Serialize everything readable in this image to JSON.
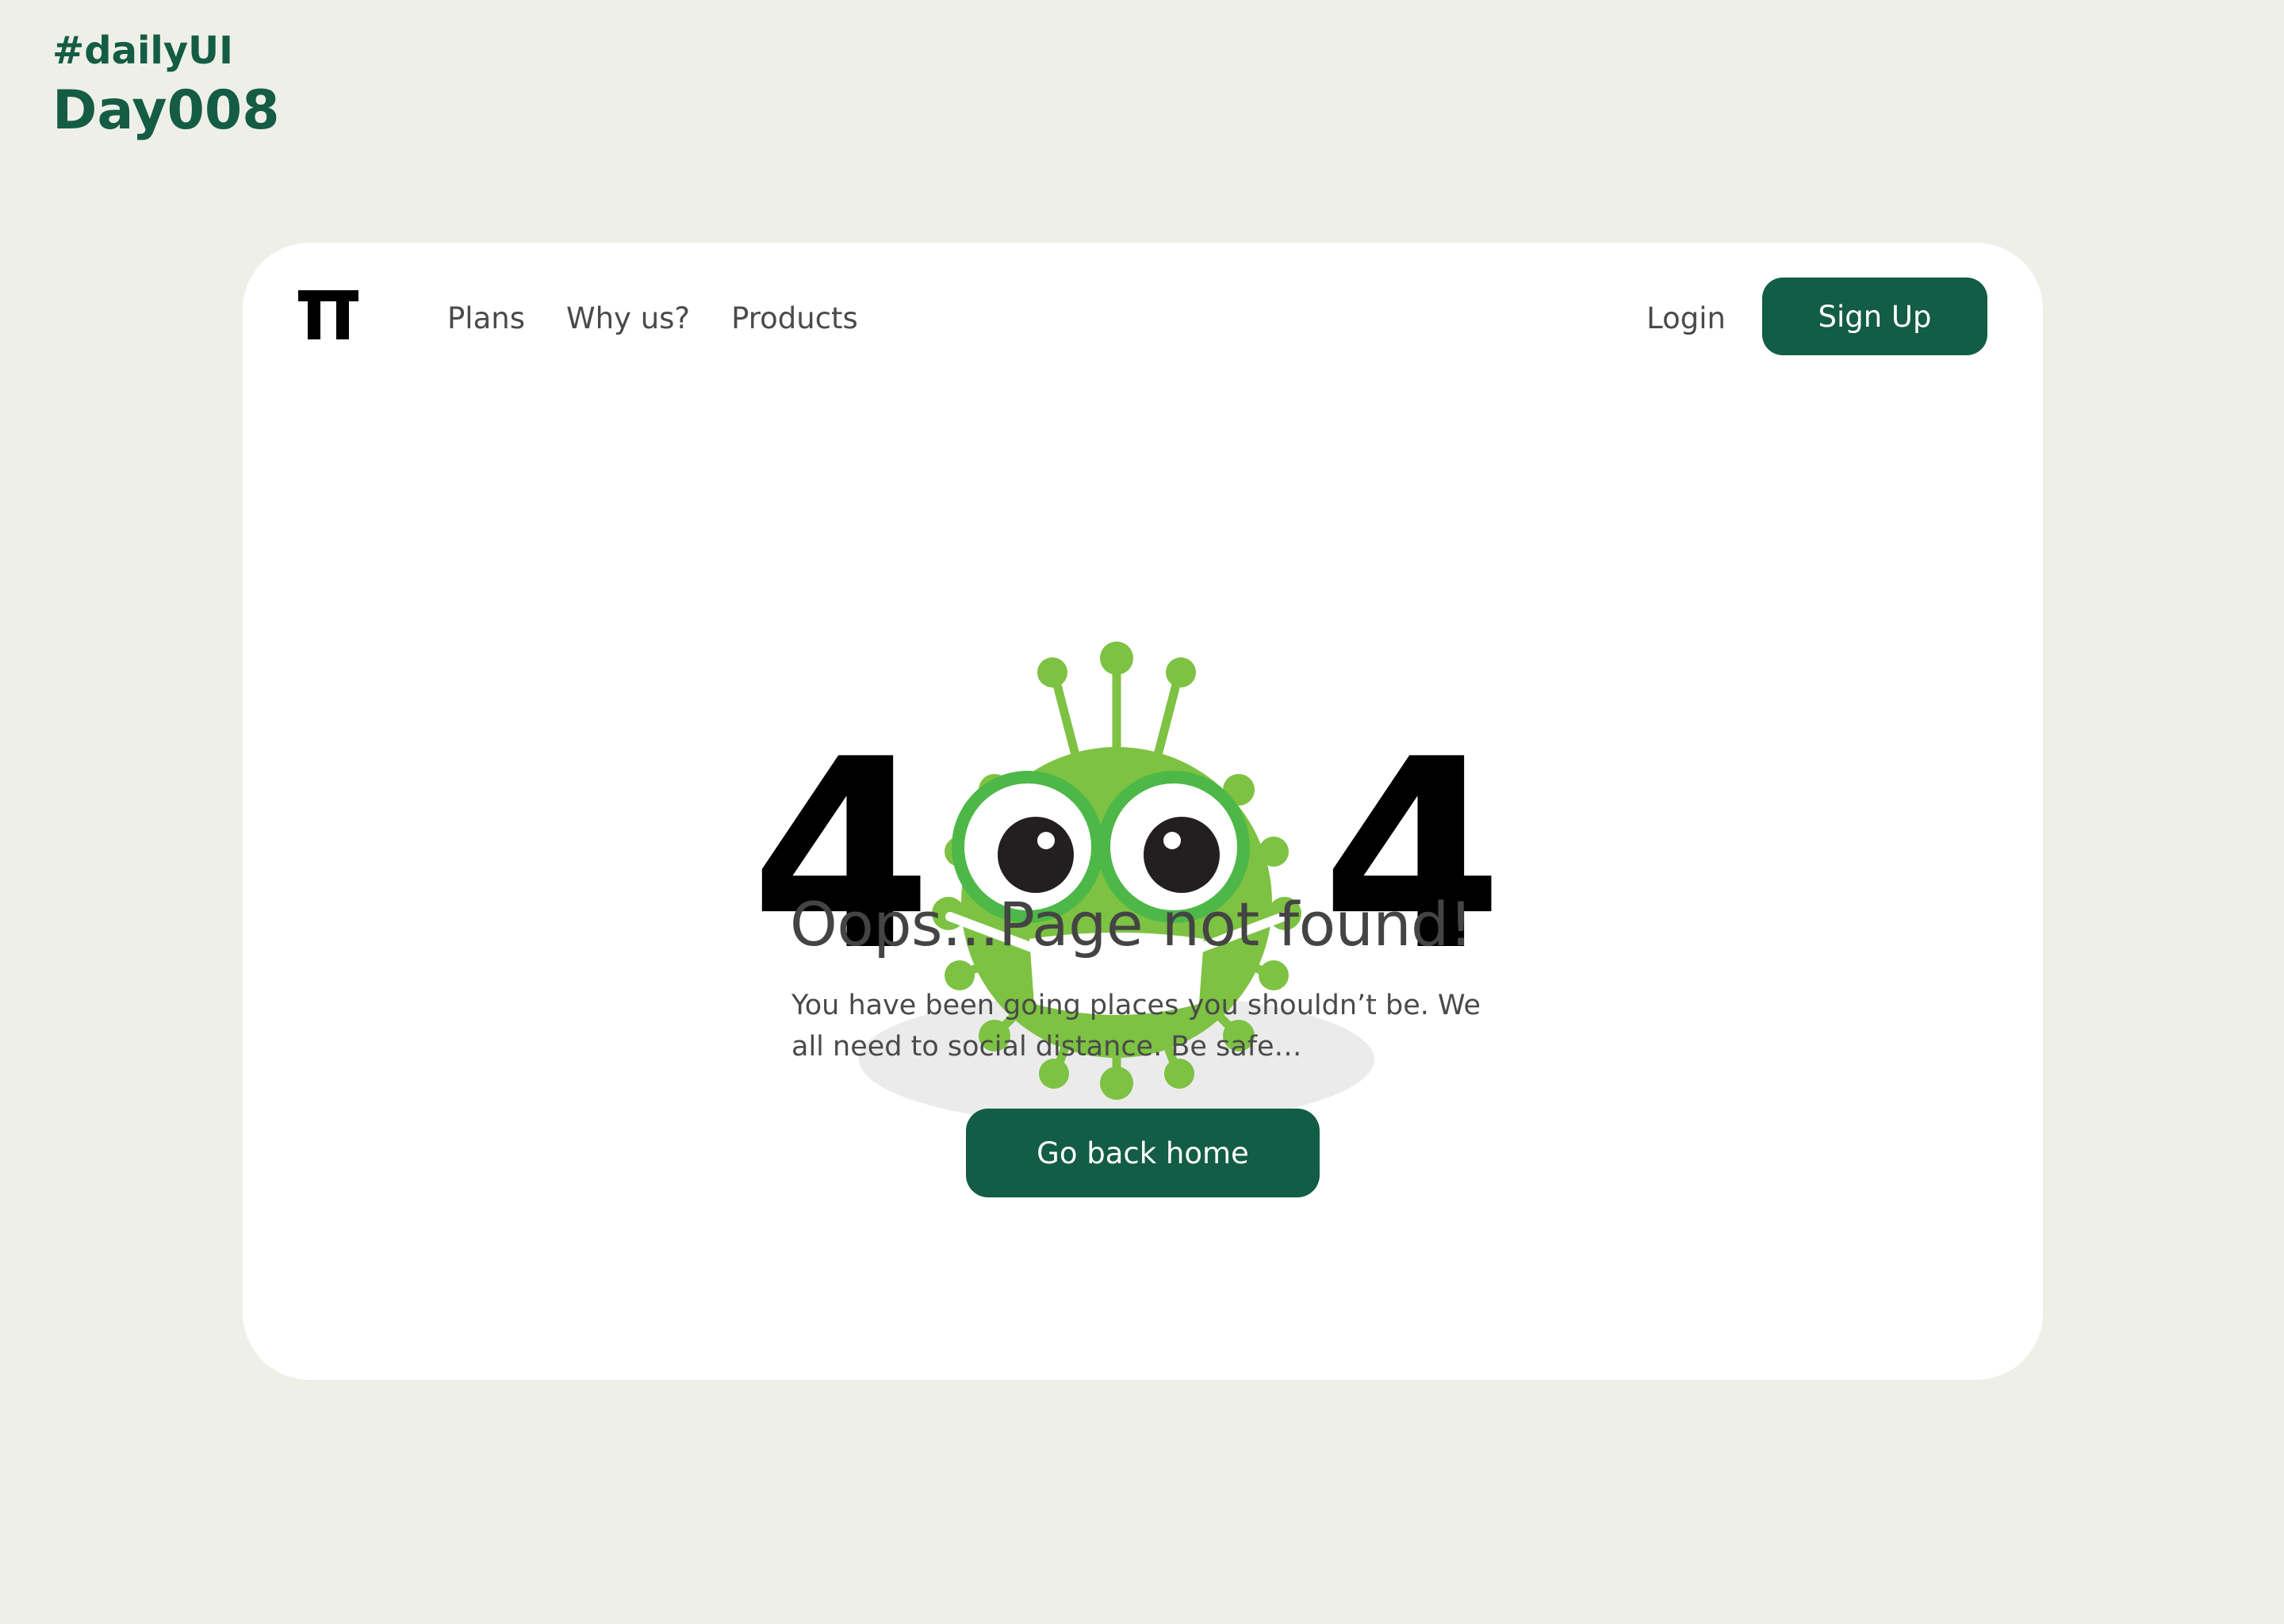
{
  "brand": {
    "hashtag": "#dailyUI",
    "day": "Day008",
    "accent_color": "#135c45",
    "background_color": "#eef0e7"
  },
  "header": {
    "logo_icon": "tt-logo-icon",
    "nav": [
      "Plans",
      "Why us?",
      "Products"
    ],
    "login_label": "Login",
    "signup_label": "Sign Up"
  },
  "error": {
    "code_left": "4",
    "code_right": "4",
    "illustration": "masked-virus-icon",
    "headline": "Oops...Page not found!",
    "message": "You have been going places you shouldn’t be. We all need to social distance. Be safe…",
    "button_label": "Go back home"
  }
}
